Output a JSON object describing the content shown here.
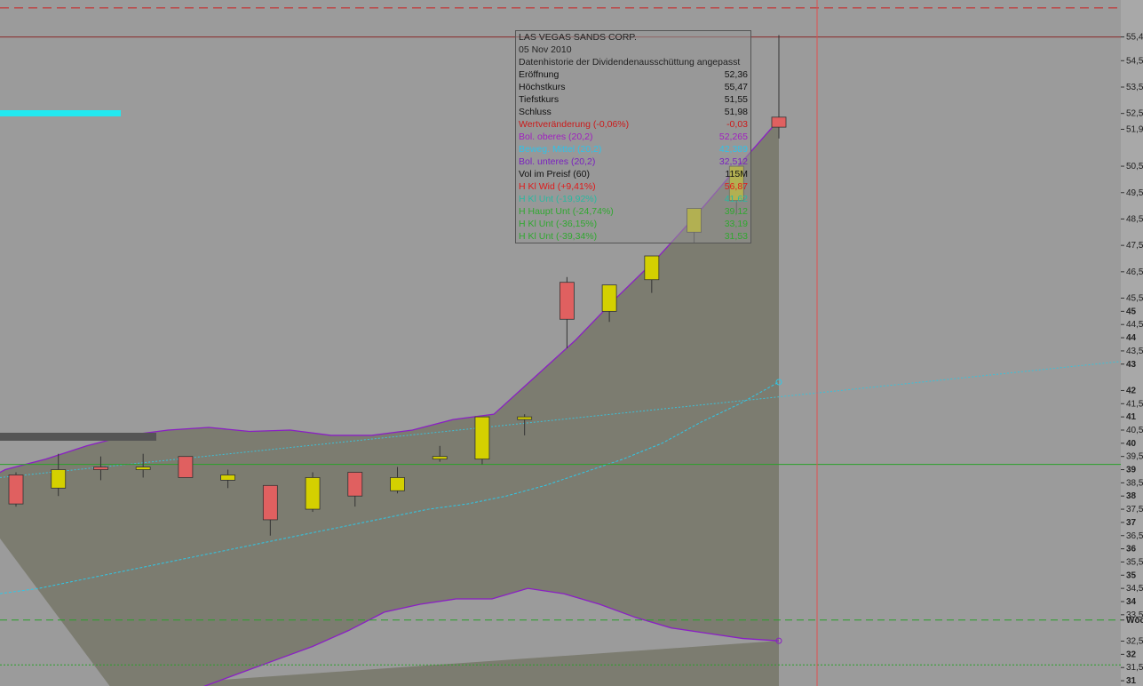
{
  "colors": {
    "background": "#9b9b9b",
    "band_fill": "#7c7c70",
    "band_line": "#8a1fc4",
    "ma_line": "#2ec8e8",
    "trend_line": "#3cc0d8",
    "up_candle": "#d4d000",
    "down_candle": "#e06060",
    "red_line": "#cc2020",
    "green_line": "#2aa02a",
    "crosshair": "#e05050"
  },
  "chart_data": {
    "type": "candlestick",
    "ylim": [
      30.8,
      56.8
    ],
    "y_ticks": [
      "55,4",
      "54,5",
      "53,5",
      "52,5",
      "51,9",
      "50,5",
      "49,5",
      "48,5",
      "47,5",
      "46,5",
      "45,5",
      "45",
      "44,5",
      "44",
      "43,5",
      "43",
      "42",
      "41,5",
      "41",
      "40,5",
      "40",
      "39,5",
      "39",
      "38,5",
      "38",
      "37,5",
      "37",
      "36,5",
      "36",
      "35,5",
      "35",
      "34,5",
      "34",
      "33,5",
      "Wöc",
      "32,5",
      "32",
      "31,5",
      "31"
    ],
    "candles": [
      {
        "open": 38.8,
        "high": 38.9,
        "low": 37.6,
        "close": 37.7
      },
      {
        "open": 38.3,
        "high": 39.6,
        "low": 38.0,
        "close": 39.0
      },
      {
        "open": 39.1,
        "high": 39.5,
        "low": 38.6,
        "close": 39.0
      },
      {
        "open": 39.0,
        "high": 39.6,
        "low": 38.7,
        "close": 39.1
      },
      {
        "open": 39.5,
        "high": 39.5,
        "low": 38.7,
        "close": 38.7
      },
      {
        "open": 38.6,
        "high": 39.0,
        "low": 38.3,
        "close": 38.8
      },
      {
        "open": 38.4,
        "high": 38.4,
        "low": 36.5,
        "close": 37.1
      },
      {
        "open": 37.5,
        "high": 38.9,
        "low": 37.4,
        "close": 38.7
      },
      {
        "open": 38.9,
        "high": 38.9,
        "low": 37.6,
        "close": 38.0
      },
      {
        "open": 38.2,
        "high": 39.1,
        "low": 38.1,
        "close": 38.7
      },
      {
        "open": 39.4,
        "high": 39.9,
        "low": 39.3,
        "close": 39.5
      },
      {
        "open": 39.4,
        "high": 41.0,
        "low": 39.2,
        "close": 41.0
      },
      {
        "open": 40.9,
        "high": 41.1,
        "low": 40.3,
        "close": 41.0
      },
      {
        "open": 46.1,
        "high": 46.3,
        "low": 43.6,
        "close": 44.7
      },
      {
        "open": 45.0,
        "high": 45.5,
        "low": 44.6,
        "close": 46.0
      },
      {
        "open": 46.2,
        "high": 47.0,
        "low": 45.7,
        "close": 47.1
      },
      {
        "open": 48.0,
        "high": 48.9,
        "low": 47.6,
        "close": 48.9
      },
      {
        "open": 49.2,
        "high": 50.0,
        "low": 48.7,
        "close": 50.5
      },
      {
        "open": 52.36,
        "high": 55.47,
        "low": 51.55,
        "close": 51.98
      }
    ],
    "bollinger_upper": [
      38.2,
      39.0,
      39.4,
      39.9,
      40.3,
      40.5,
      40.6,
      40.45,
      40.5,
      40.3,
      40.3,
      40.5,
      40.9,
      41.1,
      42.5,
      43.9,
      45.5,
      47.0,
      48.7,
      50.5,
      52.265
    ],
    "bollinger_lower": [
      29.6,
      30.2,
      30.8,
      31.3,
      31.8,
      32.3,
      32.9,
      33.6,
      33.9,
      34.1,
      34.1,
      34.5,
      34.3,
      33.9,
      33.4,
      33.0,
      32.8,
      32.6,
      32.512
    ],
    "moving_average": [
      34.3,
      34.5,
      34.8,
      35.1,
      35.4,
      35.7,
      36.0,
      36.3,
      36.6,
      36.9,
      37.2,
      37.5,
      37.7,
      38.0,
      38.4,
      38.9,
      39.4,
      40.0,
      40.8,
      41.5,
      42.32
    ],
    "trend_line": [
      38.7,
      43.1
    ],
    "hlines": {
      "red_dashed": 56.5,
      "red_solid": 55.4,
      "green_solid": 39.2,
      "green_dashed": 33.3,
      "green_dotted": 31.6
    },
    "legend_box": {
      "title": "LAS VEGAS SANDS CORP.",
      "date": "05 Nov 2010",
      "note": "Datenhistorie der Dividendenausschüttung angepasst",
      "rows": [
        {
          "label": "Eröffnung",
          "value": "52,36",
          "color": "#111111"
        },
        {
          "label": "Höchstkurs",
          "value": "55,47",
          "color": "#111111"
        },
        {
          "label": "Tiefstkurs",
          "value": "51,55",
          "color": "#111111"
        },
        {
          "label": "Schluss",
          "value": "51,98",
          "color": "#111111"
        },
        {
          "label": "Wertveränderung (-0,06%)",
          "value": "-0,03",
          "color": "#cc1a1a"
        },
        {
          "label": "Bol. oberes (20,2)",
          "value": "52,265",
          "color": "#a020c0"
        },
        {
          "label": "Beweg. Mittel (20,2)",
          "value": "42,389",
          "color": "#2fc2e8"
        },
        {
          "label": "Bol. unteres (20,2)",
          "value": "32,512",
          "color": "#7a20c0"
        },
        {
          "label": "Vol im Preisf (60)",
          "value": "115M",
          "color": "#111111"
        },
        {
          "label": "H Kl Wid (+9,41%)",
          "value": "56,87",
          "color": "#e01a1a"
        },
        {
          "label": "H Kl Unt (-19,92%)",
          "value": "41,62",
          "color": "#2ab8a0"
        },
        {
          "label": "H Haupt Unt (-24,74%)",
          "value": "39,12",
          "color": "#30a830"
        },
        {
          "label": "H Kl Unt (-36,15%)",
          "value": "33,19",
          "color": "#30a830"
        },
        {
          "label": "H Kl Unt (-39,34%)",
          "value": "31,53",
          "color": "#30a830"
        }
      ]
    }
  }
}
